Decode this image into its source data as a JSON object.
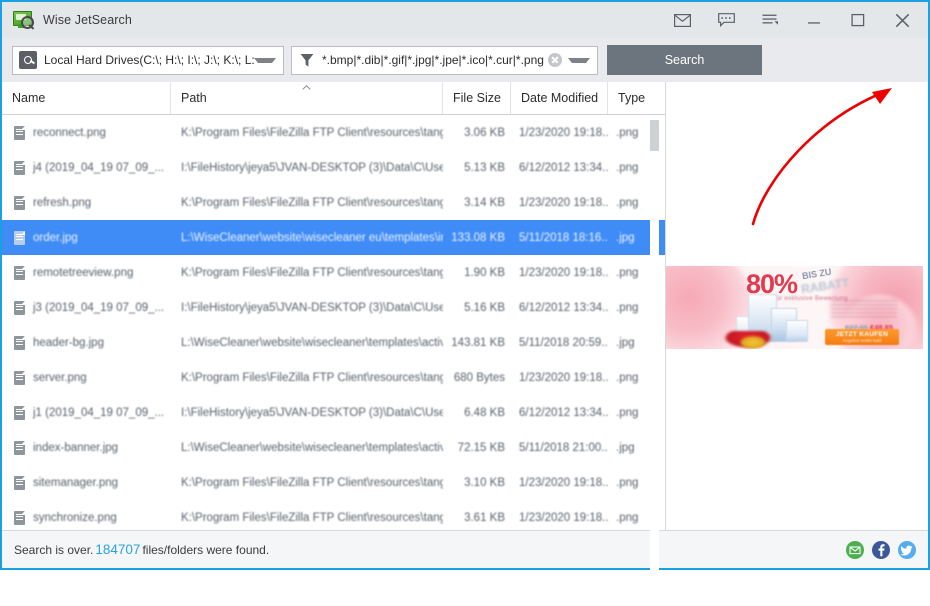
{
  "window": {
    "title": "Wise JetSearch",
    "app_icon": "monitor-magnifier-icon",
    "buttons": {
      "feedback": "mail-icon",
      "comment": "comment-icon",
      "menu": "menu-list-icon",
      "minimize": "minimize-icon",
      "maximize": "maximize-icon",
      "close": "close-icon"
    }
  },
  "toolbar": {
    "drive_selector": {
      "icon": "hard-drive-icon",
      "value": "Local Hard Drives(C:\\; H:\\; I:\\; J:\\; K:\\; L:\\; M",
      "dropdown_icon": "chevron-down-icon"
    },
    "filter": {
      "icon": "funnel-icon",
      "value": "*.bmp|*.dib|*.gif|*.jpg|*.jpe|*.ico|*.cur|*.png",
      "clear_icon": "clear-circle-icon",
      "dropdown_icon": "chevron-down-icon"
    },
    "search_button": "Search"
  },
  "preview_toggle": {
    "icon": "preview-pane-icon",
    "highlight_color": "#ffe800",
    "annotation": "red-curved-arrow"
  },
  "table": {
    "columns": [
      {
        "key": "name",
        "label": "Name"
      },
      {
        "key": "path",
        "label": "Path",
        "sorted": "asc"
      },
      {
        "key": "size",
        "label": "File Size"
      },
      {
        "key": "date",
        "label": "Date Modified"
      },
      {
        "key": "type",
        "label": "Type"
      }
    ],
    "rows": [
      {
        "name": "reconnect.png",
        "path": "K:\\Program Files\\FileZilla FTP Client\\resources\\tango\\...",
        "size": "3.06 KB",
        "date": "1/23/2020 19:18...",
        "type": ".png",
        "selected": false
      },
      {
        "name": "j4 (2019_04_19 07_09_...",
        "path": "I:\\FileHistory\\jeya5\\JVAN-DESKTOP (3)\\Data\\C\\Users...",
        "size": "5.13 KB",
        "date": "6/12/2012 13:34...",
        "type": ".png",
        "selected": false
      },
      {
        "name": "refresh.png",
        "path": "K:\\Program Files\\FileZilla FTP Client\\resources\\tango\\...",
        "size": "3.14 KB",
        "date": "1/23/2020 19:18...",
        "type": ".png",
        "selected": false
      },
      {
        "name": "order.jpg",
        "path": "L:\\WiseCleaner\\website\\wisecleaner eu\\templates\\im...",
        "size": "133.08 KB",
        "date": "5/11/2018 18:16...",
        "type": ".jpg",
        "selected": true
      },
      {
        "name": "remotetreeview.png",
        "path": "K:\\Program Files\\FileZilla FTP Client\\resources\\tango\\...",
        "size": "1.90 KB",
        "date": "1/23/2020 19:18...",
        "type": ".png",
        "selected": false
      },
      {
        "name": "j3 (2019_04_19 07_09_...",
        "path": "I:\\FileHistory\\jeya5\\JVAN-DESKTOP (3)\\Data\\C\\Users...",
        "size": "5.16 KB",
        "date": "6/12/2012 13:34...",
        "type": ".png",
        "selected": false
      },
      {
        "name": "header-bg.jpg",
        "path": "L:\\WiseCleaner\\website\\wisecleaner\\templates\\activi...",
        "size": "143.81 KB",
        "date": "5/11/2018 20:59...",
        "type": ".jpg",
        "selected": false
      },
      {
        "name": "server.png",
        "path": "K:\\Program Files\\FileZilla FTP Client\\resources\\tango\\...",
        "size": "680 Bytes",
        "date": "1/23/2020 19:18...",
        "type": ".png",
        "selected": false
      },
      {
        "name": "j1 (2019_04_19 07_09_...",
        "path": "I:\\FileHistory\\jeya5\\JVAN-DESKTOP (3)\\Data\\C\\Users...",
        "size": "6.48 KB",
        "date": "6/12/2012 13:34...",
        "type": ".png",
        "selected": false
      },
      {
        "name": "index-banner.jpg",
        "path": "L:\\WiseCleaner\\website\\wisecleaner\\templates\\activi...",
        "size": "72.15 KB",
        "date": "5/11/2018 21:00...",
        "type": ".jpg",
        "selected": false
      },
      {
        "name": "sitemanager.png",
        "path": "K:\\Program Files\\FileZilla FTP Client\\resources\\tango\\...",
        "size": "3.10 KB",
        "date": "1/23/2020 19:18...",
        "type": ".png",
        "selected": false
      },
      {
        "name": "synchronize.png",
        "path": "K:\\Program Files\\FileZilla FTP Client\\resources\\tango\\...",
        "size": "3.61 KB",
        "date": "1/23/2020 19:18...",
        "type": ".png",
        "selected": false
      }
    ]
  },
  "ad": {
    "percent": "80%",
    "bis_zu": "BIS ZU",
    "rabatt": "RABATT",
    "subtitle": "Für exklusive Bewertung",
    "price_old": "€27.95",
    "price_new": "€48.85",
    "cta_main": "JETZT KAUFEN",
    "cta_sub": "Angebot endet bald"
  },
  "statusbar": {
    "prefix": "Search is over.",
    "count": "184707",
    "suffix": "files/folders were found.",
    "social": {
      "mail": "email-icon",
      "facebook": "facebook-icon",
      "twitter": "twitter-icon"
    }
  },
  "colors": {
    "window_border": "#1ba1e2",
    "selection": "#3f8cf7",
    "accent": "#2aa3e0",
    "search_button": "#6c757d"
  }
}
